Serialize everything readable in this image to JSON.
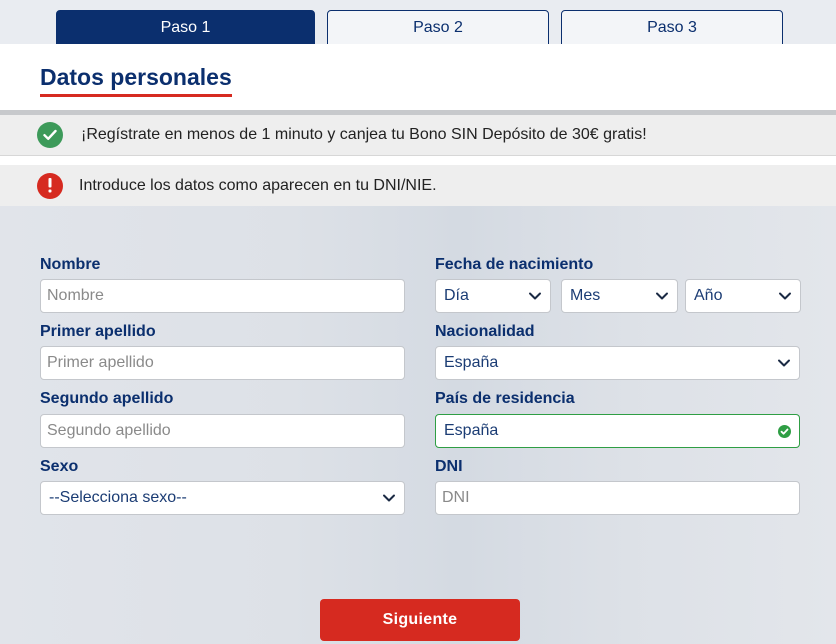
{
  "steps": [
    {
      "label": "Paso 1",
      "active": true
    },
    {
      "label": "Paso 2",
      "active": false
    },
    {
      "label": "Paso 3",
      "active": false
    }
  ],
  "header": {
    "title": "Datos personales"
  },
  "notices": {
    "success": {
      "icon": "check-circle-icon",
      "text": "¡Regístrate en menos de 1 minuto y canjea tu Bono SIN Depósito de 30€ gratis!"
    },
    "warning": {
      "icon": "exclamation-circle-icon",
      "text": "Introduce los datos como aparecen en tu DNI/NIE."
    }
  },
  "form": {
    "nombre": {
      "label": "Nombre",
      "placeholder": "Nombre",
      "value": ""
    },
    "primer_apellido": {
      "label": "Primer apellido",
      "placeholder": "Primer apellido",
      "value": ""
    },
    "segundo_apellido": {
      "label": "Segundo apellido",
      "placeholder": "Segundo apellido",
      "value": ""
    },
    "sexo": {
      "label": "Sexo",
      "selected": "--Selecciona sexo--"
    },
    "fecha": {
      "label": "Fecha de nacimiento",
      "dia": "Día",
      "mes": "Mes",
      "ano": "Año"
    },
    "nacionalidad": {
      "label": "Nacionalidad",
      "selected": "España"
    },
    "pais_residencia": {
      "label": "País de residencia",
      "selected": "España"
    },
    "dni": {
      "label": "DNI",
      "placeholder": "DNI",
      "value": ""
    }
  },
  "actions": {
    "next_label": "Siguiente"
  },
  "colors": {
    "brand_blue": "#0b2f6e",
    "accent_red": "#d62a20",
    "success_green": "#2f9e44"
  }
}
